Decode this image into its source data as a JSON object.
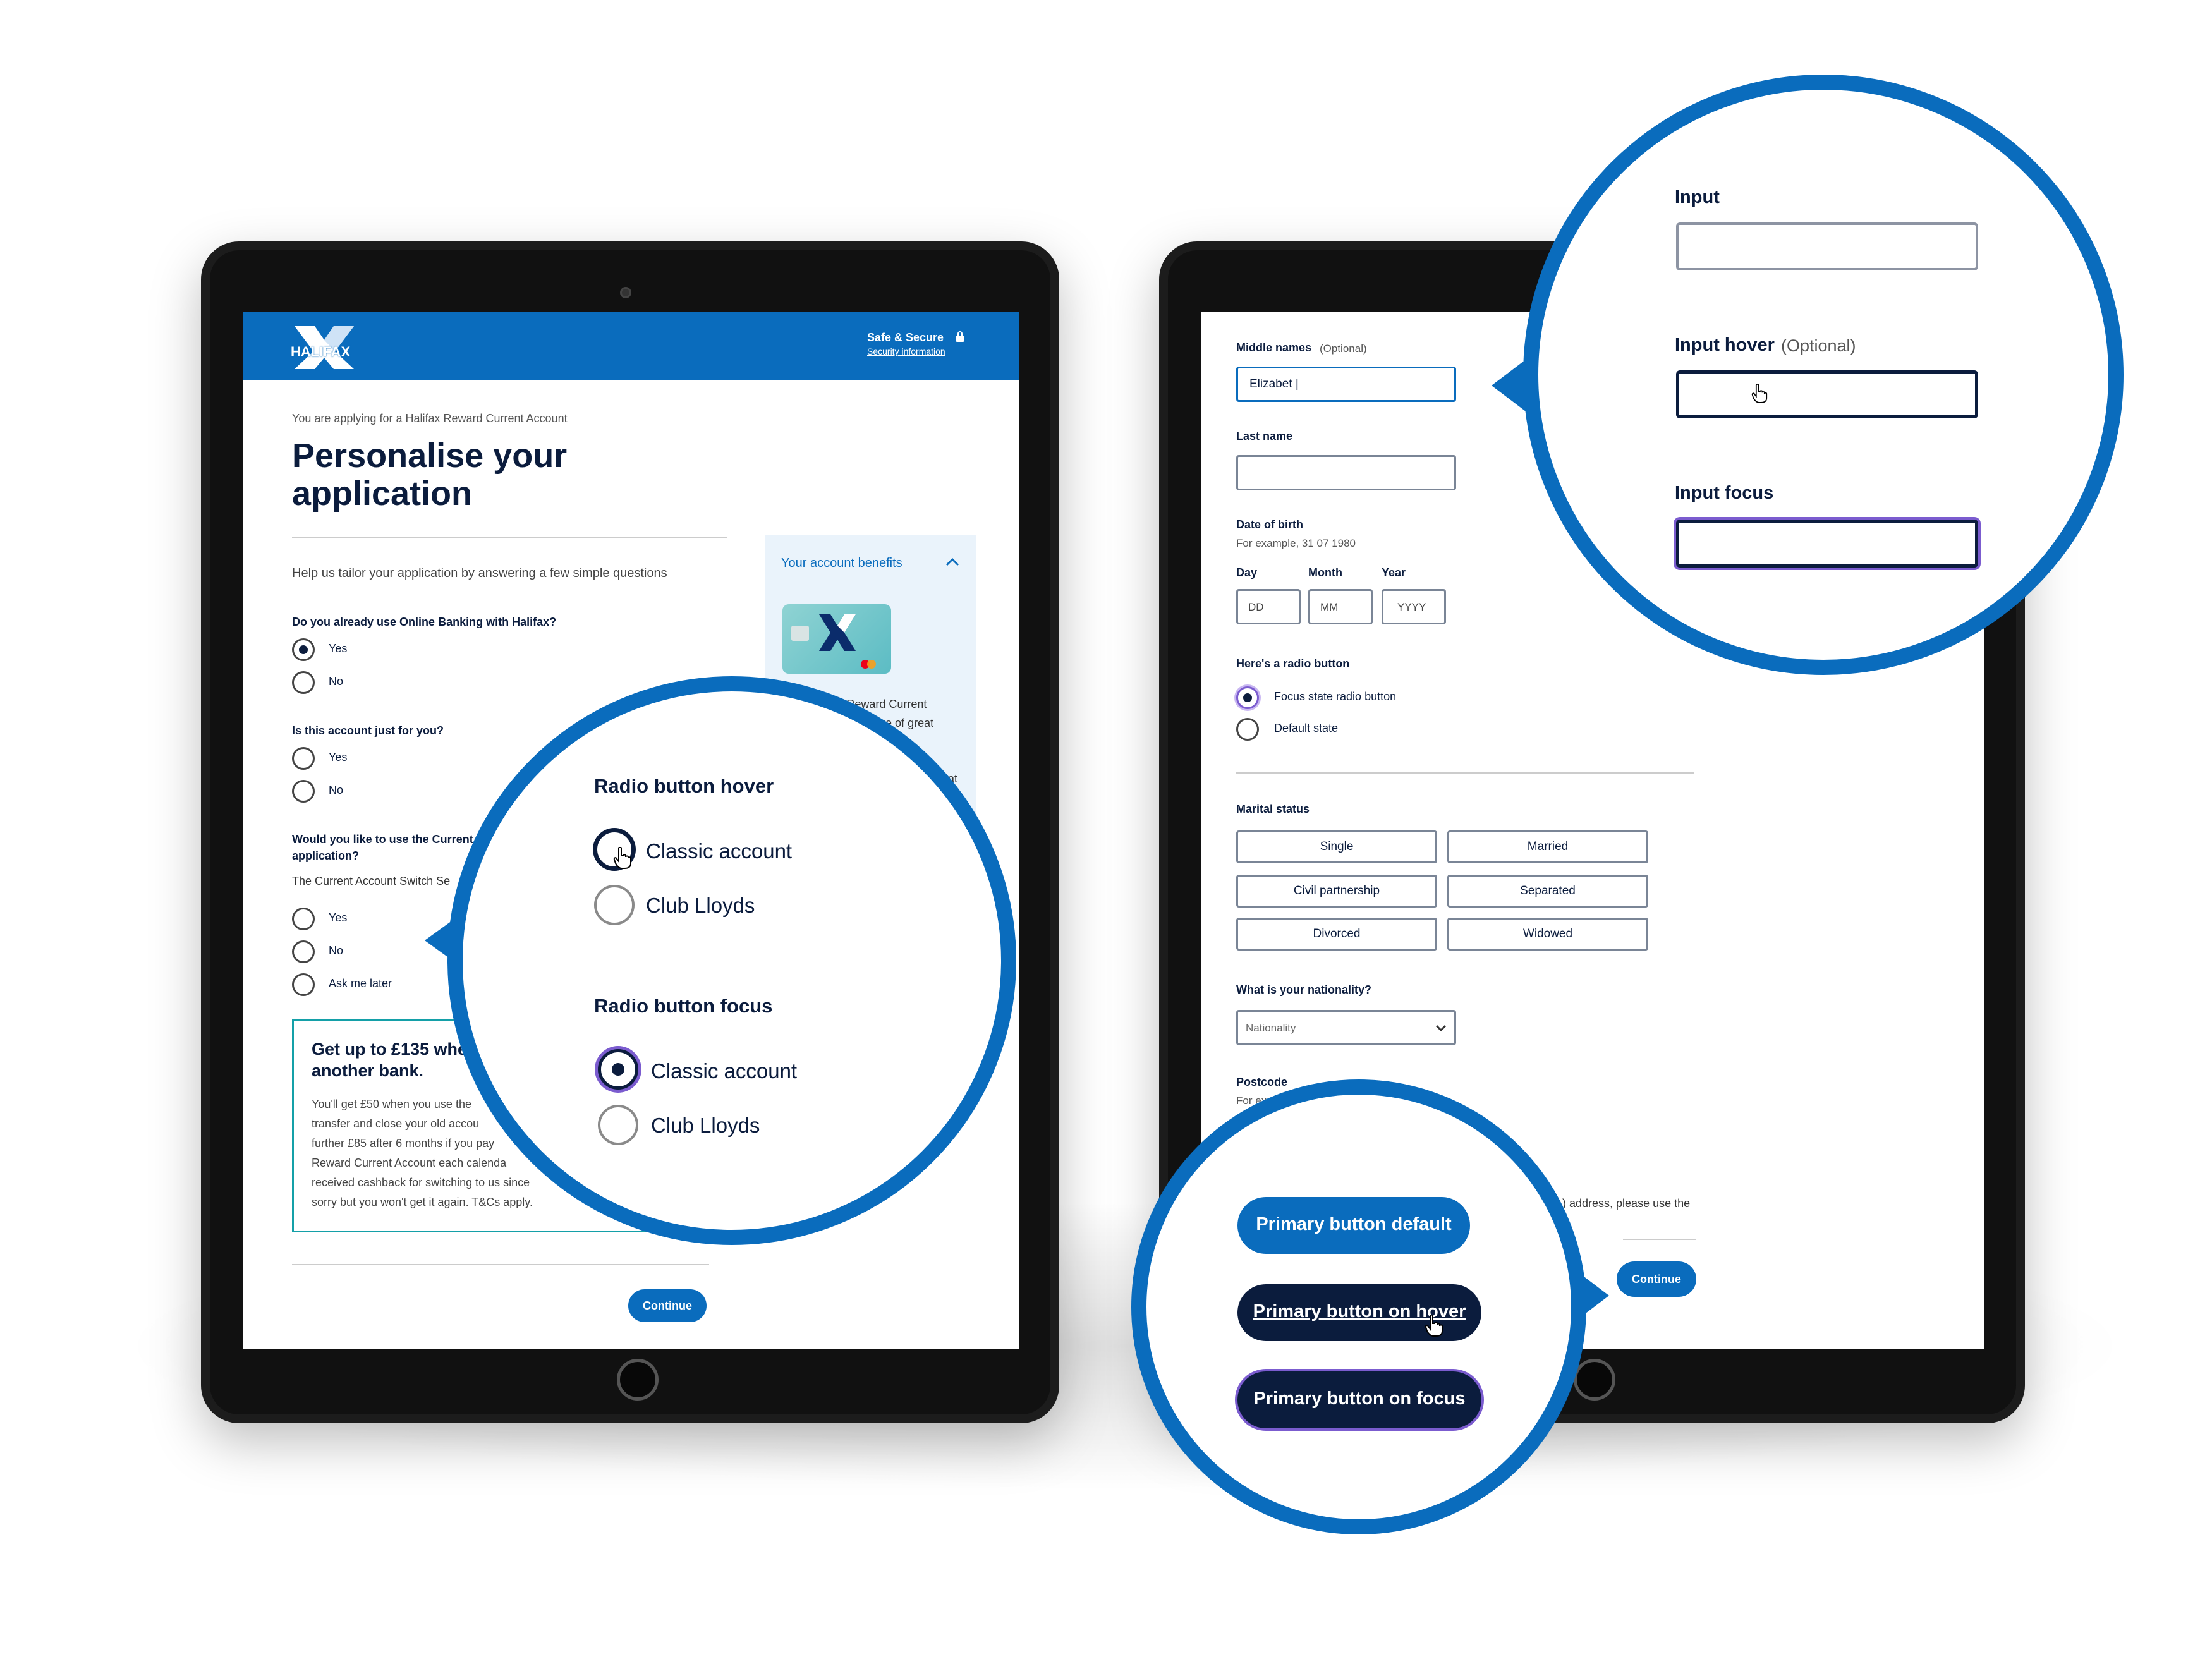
{
  "left_tablet": {
    "brand": "HALIFAX",
    "safe_secure": "Safe & Secure",
    "security_info": "Security information",
    "applying_for": "You are applying for a Halifax Reward Current Account",
    "title_line1": "Personalise your",
    "title_line2": "application",
    "intro": "Help us tailor your application by answering a few simple questions",
    "q1": "Do you already use Online Banking with Halifax?",
    "q1_options": [
      "Yes",
      "No"
    ],
    "q2": "Is this account just for you?",
    "q2_options": [
      "Yes",
      "No"
    ],
    "q3_line1": "Would you like to use the Current",
    "q3_line2": "application?",
    "q3_sub": "The Current Account Switch Se",
    "q3_options": [
      "Yes",
      "No",
      "Ask me later"
    ],
    "promo_title_line1": "Get up to £135 when",
    "promo_title_line2": "another bank.",
    "promo_lines": [
      "You'll get £50 when you use the",
      "transfer and close your old accou",
      "further £85 after 6 months if you pay",
      "Reward Current Account  each calenda",
      "received cashback for switching to us since",
      "sorry but you won't get it again. T&Cs apply."
    ],
    "benefits_title": "Your account benefits",
    "benefits_line1": "Your Halifax Reward Current",
    "benefits_line2": "a range of great",
    "benefits_line3": "hat",
    "continue": "Continue"
  },
  "radio_zoom": {
    "hover_title": "Radio button hover",
    "focus_title": "Radio button focus",
    "option1": "Classic account",
    "option2": "Club Lloyds"
  },
  "right_tablet": {
    "middle_names_label": "Middle names",
    "optional": "(Optional)",
    "middle_names_value": "Elizabet |",
    "last_name_label": "Last name",
    "dob_label": "Date of birth",
    "dob_hint": "For example, 31 07 1980",
    "day_label": "Day",
    "month_label": "Month",
    "year_label": "Year",
    "day_ph": "DD",
    "month_ph": "MM",
    "year_ph": "YYYY",
    "radio_label": "Here's a radio button",
    "radio_focus": "Focus state radio button",
    "radio_default": "Default state",
    "marital_label": "Marital status",
    "marital_options": [
      "Single",
      "Married",
      "Civil partnership",
      "Separated",
      "Divorced",
      "Widowed"
    ],
    "nationality_label": "What is your nationality?",
    "nationality_ph": "Nationality",
    "postcode_label": "Postcode",
    "postcode_hint": "For exa",
    "address_note": ") address, please use the",
    "continue": "Continue"
  },
  "input_zoom": {
    "input_label": "Input",
    "hover_label": "Input hover",
    "hover_optional": "(Optional)",
    "focus_label": "Input focus"
  },
  "button_zoom": {
    "default": "Primary button default",
    "hover": "Primary button on hover",
    "focus": "Primary button on focus"
  },
  "colors": {
    "brand_blue": "#0a6cbd",
    "navy": "#0b1c3d",
    "focus_purple": "#7b5ccf"
  }
}
